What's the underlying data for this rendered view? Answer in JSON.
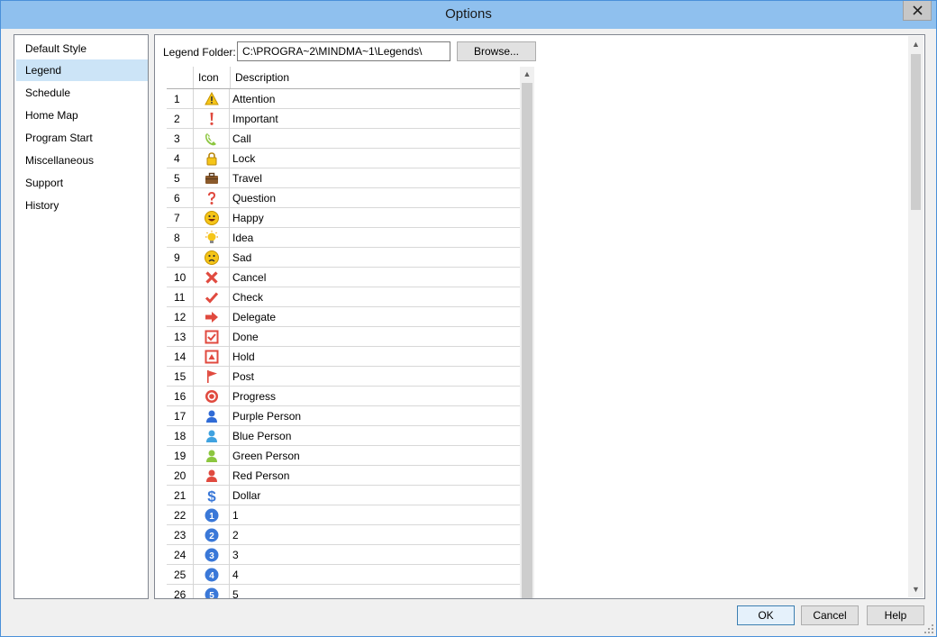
{
  "window": {
    "title": "Options"
  },
  "sidebar": {
    "items": [
      {
        "label": "Default Style",
        "selected": false
      },
      {
        "label": "Legend",
        "selected": true
      },
      {
        "label": "Schedule",
        "selected": false
      },
      {
        "label": "Home Map",
        "selected": false
      },
      {
        "label": "Program Start",
        "selected": false
      },
      {
        "label": "Miscellaneous",
        "selected": false
      },
      {
        "label": "Support",
        "selected": false
      },
      {
        "label": "History",
        "selected": false
      }
    ]
  },
  "legend": {
    "folder_label": "Legend Folder:",
    "folder_value": "C:\\PROGRA~2\\MINDMA~1\\Legends\\",
    "browse_label": "Browse...",
    "columns": {
      "num": "",
      "icon": "Icon",
      "description": "Description"
    },
    "rows": [
      {
        "num": "1",
        "icon": "warning-icon",
        "description": "Attention"
      },
      {
        "num": "2",
        "icon": "exclamation-icon",
        "description": "Important"
      },
      {
        "num": "3",
        "icon": "phone-call-icon",
        "description": "Call"
      },
      {
        "num": "4",
        "icon": "lock-icon",
        "description": "Lock"
      },
      {
        "num": "5",
        "icon": "briefcase-icon",
        "description": "Travel"
      },
      {
        "num": "6",
        "icon": "question-icon",
        "description": "Question"
      },
      {
        "num": "7",
        "icon": "happy-face-icon",
        "description": "Happy"
      },
      {
        "num": "8",
        "icon": "lightbulb-icon",
        "description": "Idea"
      },
      {
        "num": "9",
        "icon": "sad-face-icon",
        "description": "Sad"
      },
      {
        "num": "10",
        "icon": "cross-icon",
        "description": "Cancel"
      },
      {
        "num": "11",
        "icon": "checkmark-icon",
        "description": "Check"
      },
      {
        "num": "12",
        "icon": "arrow-right-icon",
        "description": "Delegate"
      },
      {
        "num": "13",
        "icon": "checkbox-icon",
        "description": "Done"
      },
      {
        "num": "14",
        "icon": "hold-box-icon",
        "description": "Hold"
      },
      {
        "num": "15",
        "icon": "flag-icon",
        "description": "Post"
      },
      {
        "num": "16",
        "icon": "target-icon",
        "description": "Progress"
      },
      {
        "num": "17",
        "icon": "person-purple-icon",
        "description": "Purple Person"
      },
      {
        "num": "18",
        "icon": "person-blue-icon",
        "description": "Blue Person"
      },
      {
        "num": "19",
        "icon": "person-green-icon",
        "description": "Green Person"
      },
      {
        "num": "20",
        "icon": "person-red-icon",
        "description": "Red Person"
      },
      {
        "num": "21",
        "icon": "dollar-icon",
        "description": "Dollar"
      },
      {
        "num": "22",
        "icon": "number-1-icon",
        "description": "1"
      },
      {
        "num": "23",
        "icon": "number-2-icon",
        "description": "2"
      },
      {
        "num": "24",
        "icon": "number-3-icon",
        "description": "3"
      },
      {
        "num": "25",
        "icon": "number-4-icon",
        "description": "4"
      },
      {
        "num": "26",
        "icon": "number-5-icon",
        "description": "5"
      }
    ]
  },
  "buttons": {
    "ok": "OK",
    "cancel": "Cancel",
    "help": "Help"
  },
  "colors": {
    "titlebar": "#8fc0ee",
    "selected": "#cce4f7",
    "red": "#e04a3f",
    "blue": "#3a78d8",
    "green": "#8cc63f",
    "yellow": "#f5c518"
  }
}
